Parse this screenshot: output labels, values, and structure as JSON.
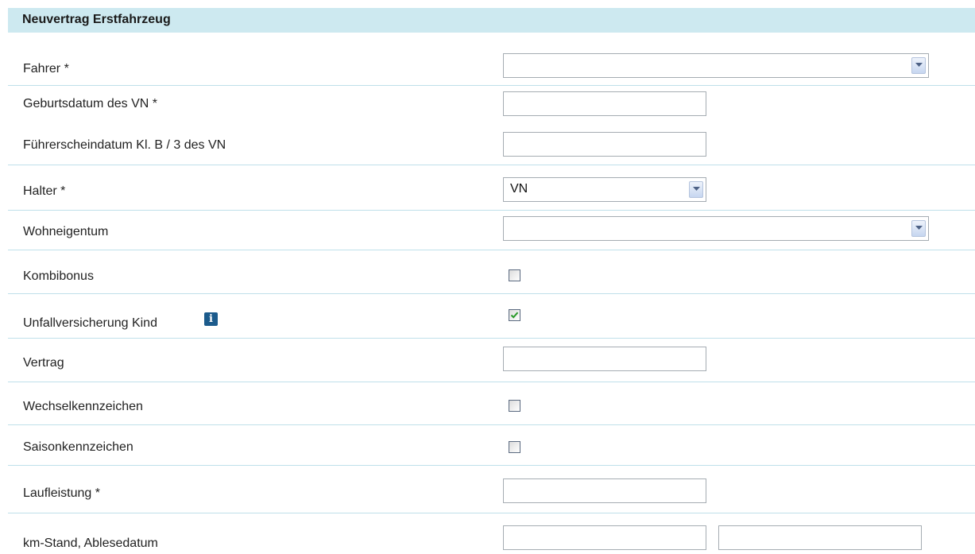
{
  "form": {
    "title": "Neuvertrag Erstfahrzeug",
    "fields": {
      "fahrer": {
        "label": "Fahrer *",
        "value": ""
      },
      "geburtsdatum": {
        "label": "Geburtsdatum des VN *",
        "value": ""
      },
      "fuehrerscheindatum": {
        "label": "Führerscheindatum Kl. B / 3 des VN",
        "value": ""
      },
      "halter": {
        "label": "Halter *",
        "value": "VN"
      },
      "wohneigentum": {
        "label": "Wohneigentum",
        "value": ""
      },
      "kombibonus": {
        "label": "Kombibonus",
        "checked": false
      },
      "unfallversicherung_kind": {
        "label": "Unfallversicherung Kind",
        "checked": true,
        "info_icon": "info-icon"
      },
      "vertrag": {
        "label": "Vertrag",
        "value": ""
      },
      "wechselkennzeichen": {
        "label": "Wechselkennzeichen",
        "checked": false
      },
      "saisonkennzeichen": {
        "label": "Saisonkennzeichen",
        "checked": false
      },
      "laufleistung": {
        "label": "Laufleistung *",
        "value": ""
      },
      "km_stand": {
        "label": "km-Stand, Ablesedatum",
        "km_value": "",
        "date_value": ""
      }
    }
  },
  "colors": {
    "header_bg": "#cde9f0",
    "separator": "#bfe0ea",
    "check_mark": "#2a9a2a",
    "info_icon": "#1c5b8c"
  }
}
